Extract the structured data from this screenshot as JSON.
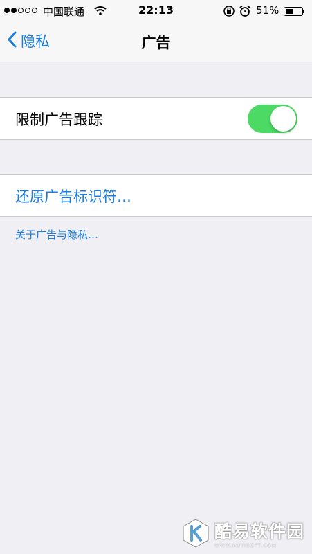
{
  "status_bar": {
    "signal": {
      "filled": 2,
      "total": 5
    },
    "carrier": "中国联通",
    "time": "22:13",
    "battery_percent": "51%",
    "battery_level": 0.51,
    "icons": [
      "wifi-icon",
      "rotation-lock-icon",
      "alarm-icon",
      "battery-icon"
    ]
  },
  "nav": {
    "back_label": "隐私",
    "title": "广告",
    "accent": "#1a7de0"
  },
  "settings": {
    "limit_ad_tracking": {
      "label": "限制广告跟踪",
      "enabled": true,
      "toggle_color": "#4cd964"
    },
    "reset_identifier": {
      "label": "还原广告标识符…"
    },
    "about_link": {
      "label": "关于广告与隐私…"
    }
  },
  "watermark": {
    "text": "酷易软件园",
    "subtext": "WWW.KUYISOFT.COM"
  }
}
